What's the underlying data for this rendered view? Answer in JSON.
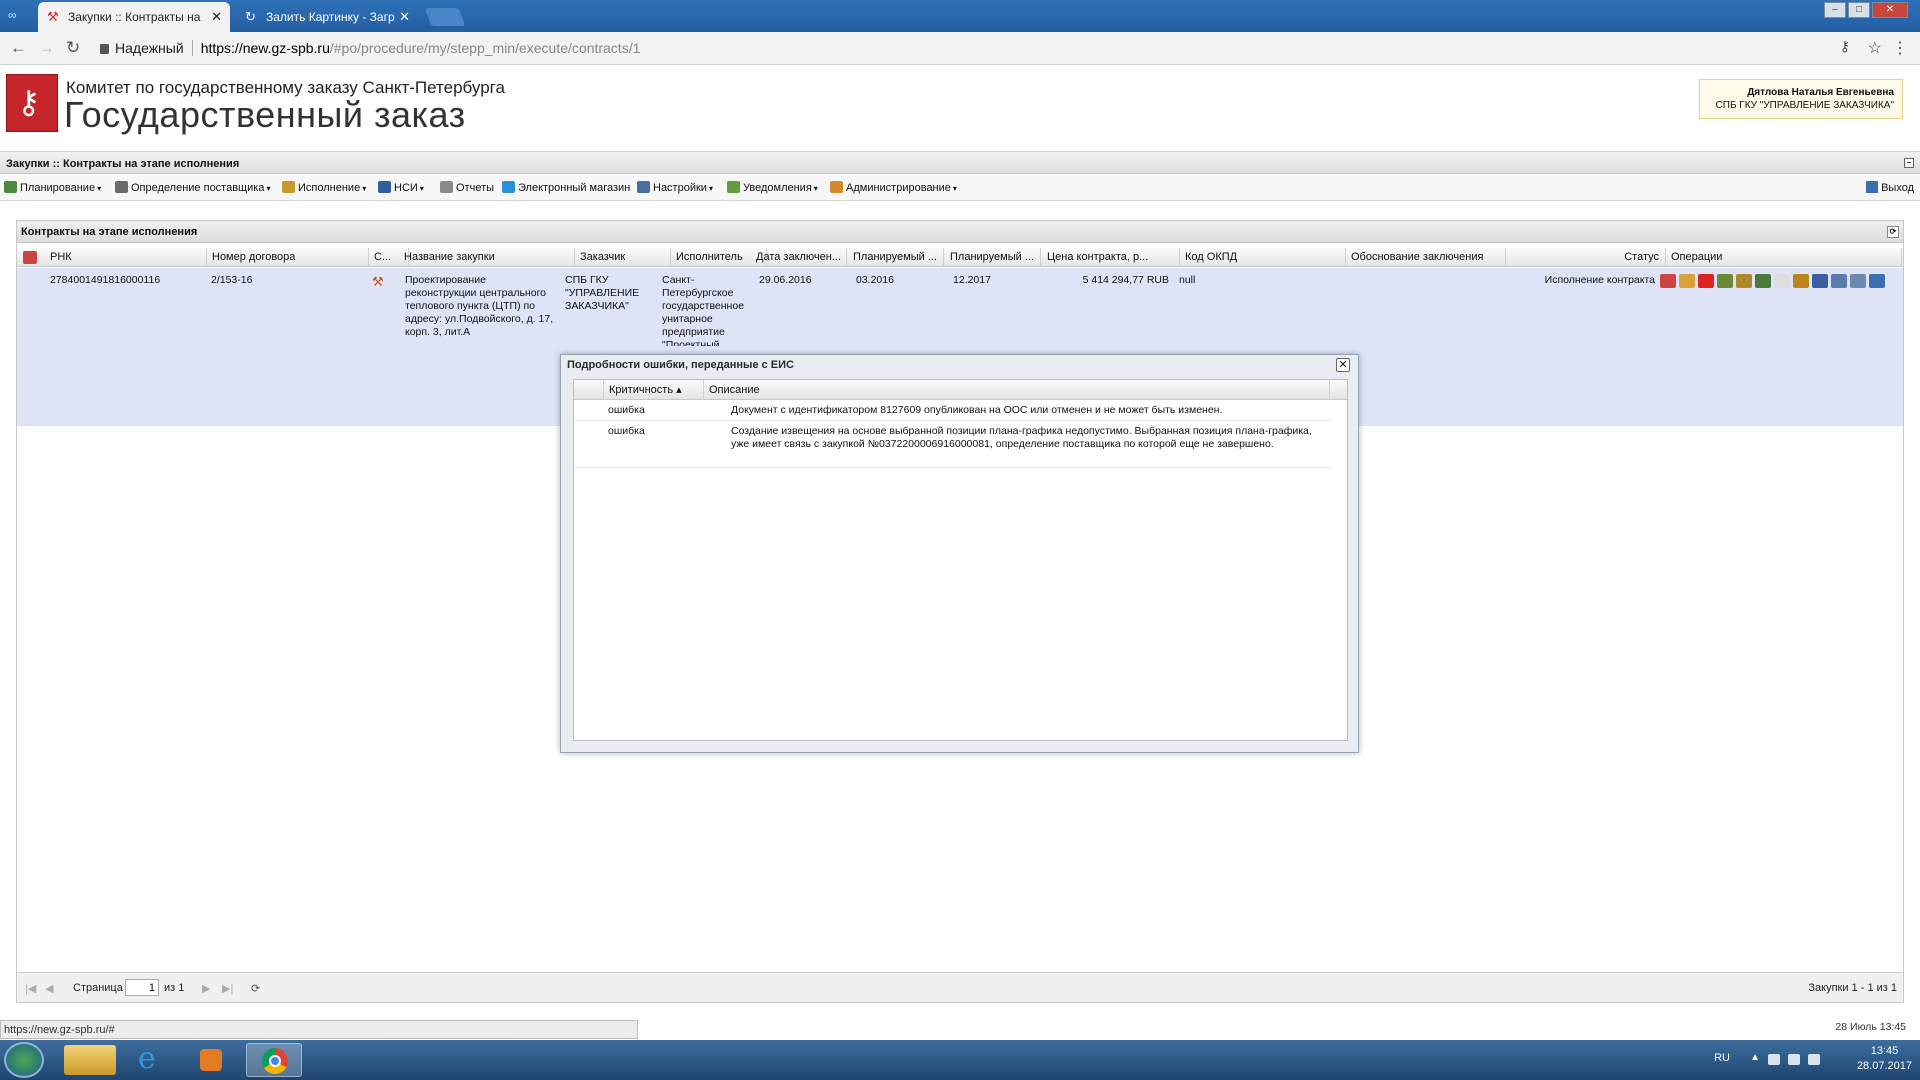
{
  "browser": {
    "tabs": [
      {
        "label": "Закупки :: Контракты на",
        "active": true
      },
      {
        "label": "Залить Картинку - Загр",
        "active": false
      }
    ],
    "security_label": "Надежный",
    "url_host": "https://new.gz-spb.ru",
    "url_path": "/#po/procedure/my/stepp_min/execute/contracts/1"
  },
  "banner": {
    "org_line": "Комитет по государственному заказу Санкт-Петербурга",
    "title": "Государственный заказ",
    "user_name": "Дятлова Наталья Евгеньевна",
    "user_org": "СПБ ГКУ \"УПРАВЛЕНИЕ ЗАКАЗЧИКА\""
  },
  "panel_title": "Закупки :: Контракты на этапе исполнения",
  "menu": {
    "items": [
      {
        "label": "Планирование",
        "icon": "planning-icon",
        "color": "#4b8a3a"
      },
      {
        "label": "Определение поставщика",
        "icon": "supplier-icon",
        "color": "#6a6a6a"
      },
      {
        "label": "Исполнение",
        "icon": "execution-icon",
        "color": "#c89a2a"
      },
      {
        "label": "НСИ",
        "icon": "book-icon",
        "color": "#2f5f9e"
      },
      {
        "label": "Отчеты",
        "icon": "report-icon",
        "color": "#8a8a8a"
      },
      {
        "label": "Электронный магазин",
        "icon": "cart-icon",
        "color": "#2d8fd6"
      },
      {
        "label": "Настройки",
        "icon": "wrench-icon",
        "color": "#4a6f9e"
      },
      {
        "label": "Уведомления",
        "icon": "notify-icon",
        "color": "#5f9e3a"
      },
      {
        "label": "Администрирование",
        "icon": "admin-icon",
        "color": "#d4892d"
      }
    ],
    "exit_label": "Выход"
  },
  "grid": {
    "title": "Контракты на этапе исполнения",
    "columns": [
      "РНК",
      "Номер договора",
      "С...",
      "Название закупки",
      "Заказчик",
      "Исполнитель",
      "Дата заключен...",
      "Планируемый ...",
      "Планируемый ...",
      "Цена контракта, р...",
      "Код ОКПД",
      "Обоснование заключения",
      "Статус",
      "Операции"
    ],
    "row": {
      "rnk": "2784001491816000116",
      "contract_no": "2/153-16",
      "name": "Проектирование реконструкции центрального теплового пункта (ЦТП) по адресу: ул.Подвойского, д. 17, корп. 3, лит.А",
      "customer": "СПБ ГКУ \"УПРАВЛЕНИЕ ЗАКАЗЧИКА\"",
      "executor": "Санкт-Петербургское государственное унитарное предприятие \"Проектный",
      "date": "29.06.2016",
      "plan1": "03.2016",
      "plan2": "12.2017",
      "price": "5 414 294,77 RUB",
      "okpd": "null",
      "status": "Исполнение контракта"
    },
    "op_icon_colors": [
      "#c44",
      "#d9a23a",
      "#d22",
      "#6a8a3a",
      "#b08a2a",
      "#4a7a3a",
      "#ddd",
      "#b8861a",
      "#3a5fa0",
      "#5a7ab0",
      "#6a8ab0",
      "#3a6fb4"
    ],
    "pager": {
      "page_label": "Страница",
      "page_value": "1",
      "of_label": "из 1",
      "summary": "Закупки 1 - 1 из 1"
    }
  },
  "dialog": {
    "title": "Подробности ошибки, переданные с ЕИС",
    "col_severity": "Критичность",
    "col_description": "Описание",
    "rows": [
      {
        "severity": "ошибка",
        "description": "Документ с идентификатором 8127609 опубликован на ООС или отменен и не может быть изменен."
      },
      {
        "severity": "ошибка",
        "description": "Создание извещения на основе выбранной позиции плана-графика недопустимо. Выбранная позиция плана-графика, уже имеет связь с закупкой №0372200006916000081, определение поставщика по которой еще не завершено."
      }
    ]
  },
  "status_url": "https://new.gz-spb.ru/#",
  "page_datetime": "28 Июль 13:45",
  "taskbar": {
    "lang": "RU",
    "time": "13:45",
    "date": "28.07.2017"
  }
}
